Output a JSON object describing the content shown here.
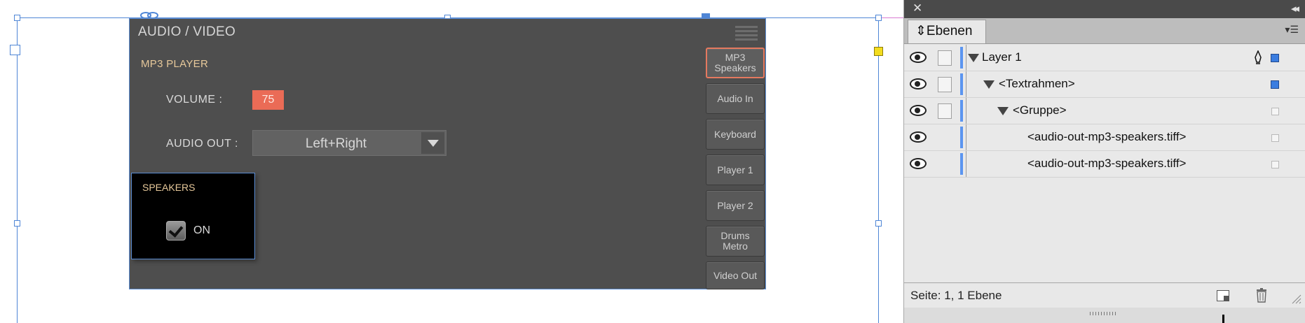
{
  "device": {
    "title": "AUDIO / VIDEO",
    "section_title": "MP3 PLAYER",
    "volume_label": "VOLUME :",
    "volume_value": "75",
    "audio_out_label": "AUDIO OUT :",
    "audio_out_value": "Left+Right",
    "speakers_title": "SPEAKERS",
    "speakers_on_label": "ON",
    "speakers_checked": true,
    "side_buttons": [
      {
        "label": "MP3 Speakers",
        "line1": "MP3",
        "line2": "Speakers",
        "active": true
      },
      {
        "label": "Audio In",
        "active": false
      },
      {
        "label": "Keyboard",
        "active": false
      },
      {
        "label": "Player 1",
        "active": false
      },
      {
        "label": "Player 2",
        "active": false
      },
      {
        "label": "Drums Metro",
        "line1": "Drums",
        "line2": "Metro",
        "active": false
      },
      {
        "label": "Video Out",
        "active": false
      }
    ],
    "colors": {
      "accent": "#ea6b56",
      "section": "#e6c89a",
      "background": "#4e4e4e"
    }
  },
  "layers_panel": {
    "tab_label": "Ebenen",
    "rows": [
      {
        "name": "Layer 1",
        "level": 0,
        "expandable": true
      },
      {
        "name": "<Textrahmen>",
        "level": 1,
        "expandable": true
      },
      {
        "name": "<Gruppe>",
        "level": 2,
        "expandable": true
      },
      {
        "name": "<audio-out-mp3-speakers.tiff>",
        "level": 3,
        "expandable": false
      },
      {
        "name": "<audio-out-mp3-speakers.tiff>",
        "level": 3,
        "expandable": false
      }
    ],
    "footer_status": "Seite: 1, 1 Ebene",
    "colors": {
      "layer_color": "#5b95f0"
    }
  }
}
